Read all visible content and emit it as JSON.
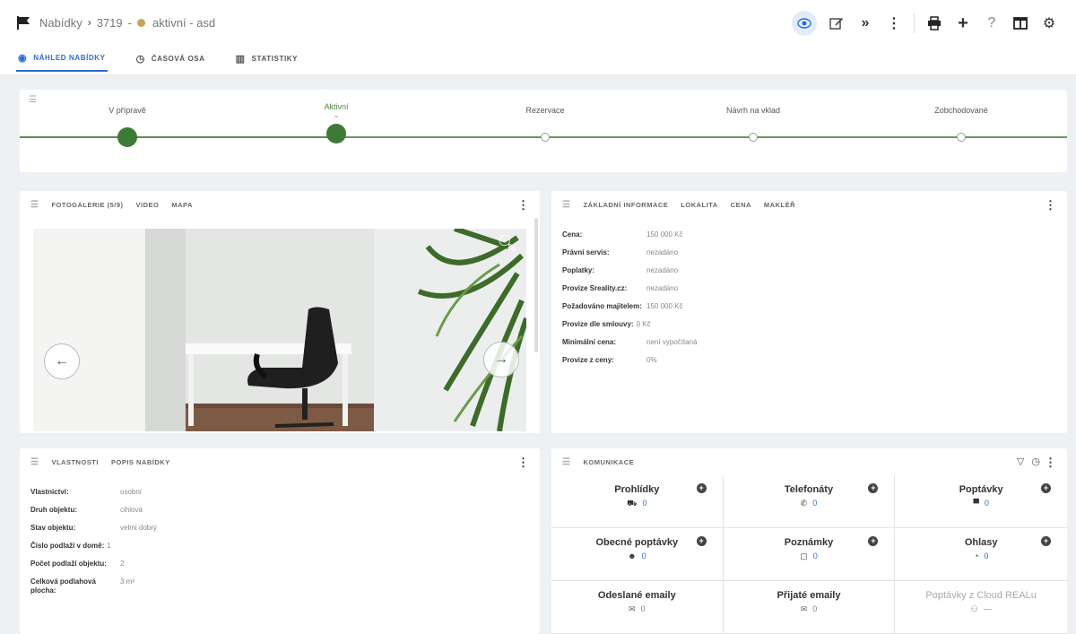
{
  "breadcrumb": {
    "root": "Nabídky",
    "separator": "›",
    "id": "3719",
    "status_dot_color": "#c9a44e",
    "current": "aktivní - asd"
  },
  "toolbar": {
    "icons": [
      "eye-icon",
      "edit-icon",
      "forward-icon",
      "more-icon",
      "print-icon",
      "plus-icon",
      "help-icon",
      "layout-icon",
      "gear-icon"
    ]
  },
  "tabs": [
    {
      "label": "NÁHLED NABÍDKY",
      "active": true
    },
    {
      "label": "ČASOVÁ OSA",
      "active": false
    },
    {
      "label": "STATISTIKY",
      "active": false
    }
  ],
  "status_steps": [
    {
      "label": "V přípravě",
      "state": "done"
    },
    {
      "label": "Aktivní",
      "state": "current"
    },
    {
      "label": "Rezervace",
      "state": "todo"
    },
    {
      "label": "Návrh na vklad",
      "state": "todo"
    },
    {
      "label": "Zobchodované",
      "state": "todo"
    }
  ],
  "gallery": {
    "tabs": [
      "FOTOGALERIE (5/9)",
      "VIDEO",
      "MAPA"
    ]
  },
  "info": {
    "tabs": [
      "ZÁKLADNÍ INFORMACE",
      "LOKALITA",
      "CENA",
      "MAKLÉŘ"
    ],
    "rows": [
      {
        "k": "Cena:",
        "v": "150 000 Kč"
      },
      {
        "k": "Právní servis:",
        "v": "nezadáno"
      },
      {
        "k": "Poplatky:",
        "v": "nezadáno"
      },
      {
        "k": "Provize Sreality.cz:",
        "v": "nezadáno"
      },
      {
        "k": "Požadováno majitelem:",
        "v": "150 000 Kč"
      },
      {
        "k": "Provize dle smlouvy:",
        "v": "0 Kč"
      },
      {
        "k": "Minimální cena:",
        "v": "není vypočítaná"
      },
      {
        "k": "Provize z ceny:",
        "v": "0%"
      }
    ]
  },
  "props": {
    "tabs": [
      "VLASTNOSTI",
      "POPIS NABÍDKY"
    ],
    "rows": [
      {
        "k": "Vlastnictví:",
        "v": "osobní"
      },
      {
        "k": "Druh objektu:",
        "v": "cihlová"
      },
      {
        "k": "Stav objektu:",
        "v": "velmi dobrý"
      },
      {
        "k": "Číslo podlaží v domě:",
        "v": "1"
      },
      {
        "k": "Počet podlaží objektu:",
        "v": "2"
      },
      {
        "k": "Celková podlahová plocha:",
        "v": "3 m²"
      }
    ]
  },
  "comm": {
    "title": "KOMUNIKACE",
    "cells": [
      {
        "title": "Prohlídky",
        "icon": "binoculars-icon",
        "glyph": "⛟",
        "value": "0",
        "plus": true
      },
      {
        "title": "Telefonáty",
        "icon": "phone-icon",
        "glyph": "✆",
        "value": "0",
        "plus": true
      },
      {
        "title": "Poptávky",
        "icon": "cart-icon",
        "glyph": "🛒",
        "value": "0",
        "plus": true
      },
      {
        "title": "Obecné poptávky",
        "icon": "robot-icon",
        "glyph": "☻",
        "value": "0",
        "plus": true
      },
      {
        "title": "Poznámky",
        "icon": "note-icon",
        "glyph": "▢",
        "value": "0",
        "plus": true
      },
      {
        "title": "Ohlasy",
        "icon": "chat-icon",
        "glyph": "◔",
        "value": "0",
        "plus": true
      },
      {
        "title": "Odeslané emaily",
        "icon": "mail-icon",
        "glyph": "✉",
        "value": "0",
        "plus": false
      },
      {
        "title": "Přijaté emaily",
        "icon": "mail-icon",
        "glyph": "✉",
        "value": "0",
        "plus": false
      },
      {
        "title": "Poptávky z Cloud REALu",
        "icon": "users-icon",
        "glyph": "👥",
        "value": "—",
        "plus": false,
        "muted": true
      }
    ]
  }
}
